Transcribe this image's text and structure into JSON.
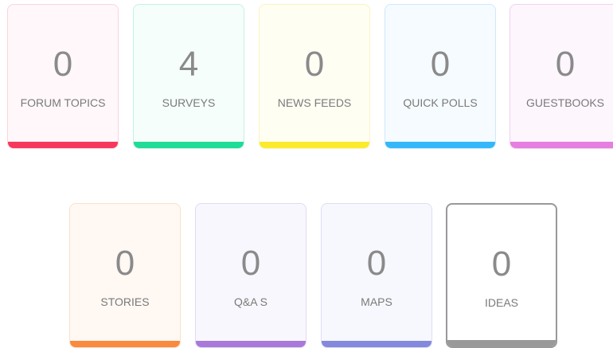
{
  "tiles": {
    "forum_topics": {
      "count": "0",
      "label": "FORUM TOPICS",
      "accent": "#f7385d"
    },
    "surveys": {
      "count": "4",
      "label": "SURVEYS",
      "accent": "#1fdc96"
    },
    "news_feeds": {
      "count": "0",
      "label": "NEWS FEEDS",
      "accent": "#fbeb2c"
    },
    "quick_polls": {
      "count": "0",
      "label": "QUICK POLLS",
      "accent": "#34b8fa"
    },
    "guestbooks": {
      "count": "0",
      "label": "GUESTBOOKS",
      "accent": "#e57fe0"
    },
    "stories": {
      "count": "0",
      "label": "STORIES",
      "accent": "#f98a3e"
    },
    "qas": {
      "count": "0",
      "label": "Q&A S",
      "accent": "#a879d9"
    },
    "maps": {
      "count": "0",
      "label": "MAPS",
      "accent": "#8489dc"
    },
    "ideas": {
      "count": "0",
      "label": "IDEAS",
      "accent": "#999999"
    }
  }
}
